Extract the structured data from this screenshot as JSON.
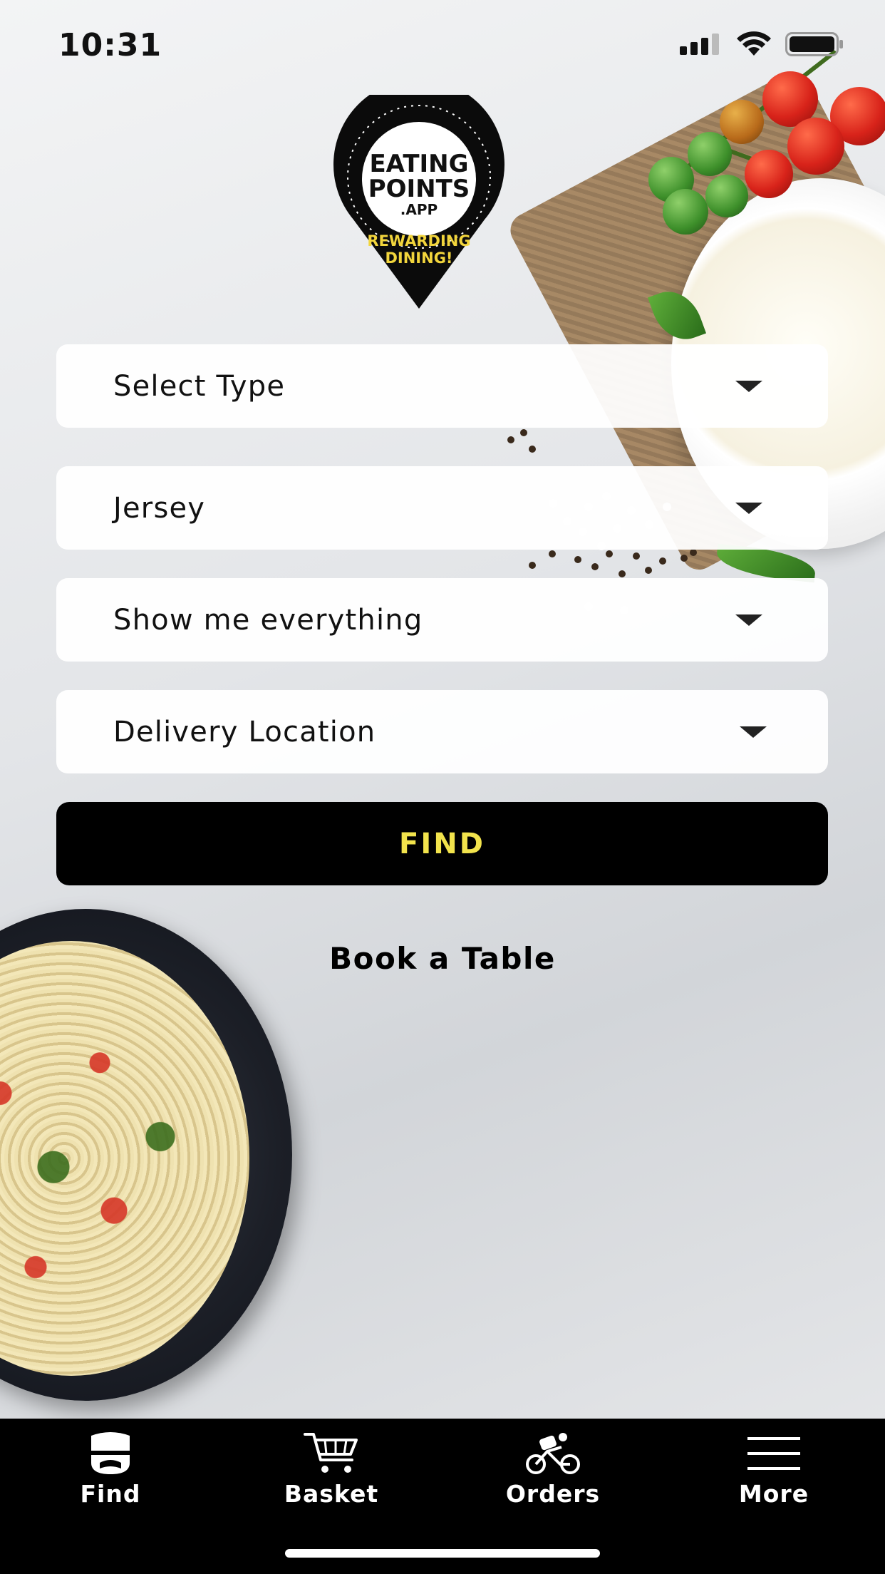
{
  "status_bar": {
    "time": "10:31"
  },
  "logo": {
    "line1": "EATING",
    "line2": "POINTS",
    "line3": ".APP",
    "tagline1": "REWARDING",
    "tagline2": "DINING!"
  },
  "filters": {
    "type": "Select Type",
    "area": "Jersey",
    "category": "Show me everything",
    "delivery": "Delivery Location"
  },
  "find_button": "FIND",
  "book_table": "Book a Table",
  "tabs": [
    {
      "label": "Find",
      "icon": "chef-icon"
    },
    {
      "label": "Basket",
      "icon": "cart-icon"
    },
    {
      "label": "Orders",
      "icon": "cyclist-icon"
    },
    {
      "label": "More",
      "icon": "menu-icon"
    }
  ],
  "colors": {
    "accent": "#f2e34c",
    "button_bg": "#000000",
    "tab_bar_bg": "#000000"
  }
}
